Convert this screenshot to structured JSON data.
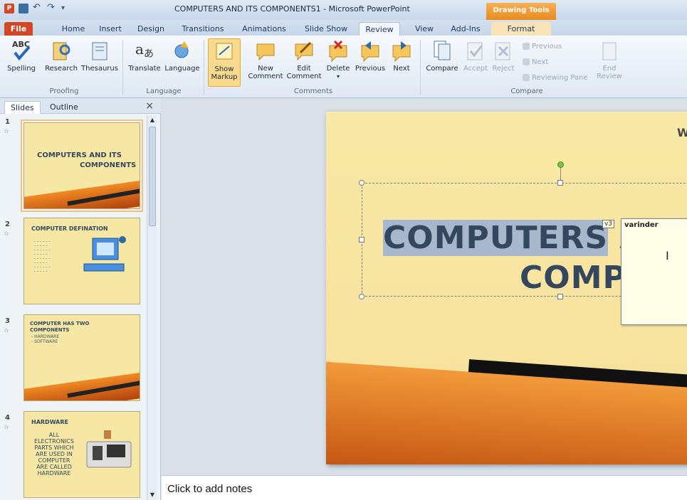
{
  "window": {
    "title": "COMPUTERS AND ITS COMPONENTS1 - Microsoft PowerPoint",
    "context_tab_header": "Drawing Tools"
  },
  "tabs": [
    "File",
    "Home",
    "Insert",
    "Design",
    "Transitions",
    "Animations",
    "Slide Show",
    "Review",
    "View",
    "Add-Ins",
    "Format"
  ],
  "ribbon": {
    "proofing": {
      "label": "Proofing",
      "spelling": "Spelling",
      "research": "Research",
      "thesaurus": "Thesaurus"
    },
    "language": {
      "label": "Language",
      "translate": "Translate",
      "language": "Language"
    },
    "comments": {
      "label": "Comments",
      "show_markup_1": "Show",
      "show_markup_2": "Markup",
      "new_1": "New",
      "new_2": "Comment",
      "edit_1": "Edit",
      "edit_2": "Comment",
      "delete": "Delete",
      "previous": "Previous",
      "next": "Next"
    },
    "compare": {
      "label": "Compare",
      "compare": "Compare",
      "accept": "Accept",
      "reject": "Reject",
      "prev_small": "Previous",
      "next_small": "Next",
      "reviewing_pane": "Reviewing Pane",
      "end_1": "End",
      "end_2": "Review"
    }
  },
  "pane": {
    "tab_slides": "Slides",
    "tab_outline": "Outline",
    "close": "×",
    "slides": [
      {
        "num": "1",
        "title_1": "COMPUTERS AND ITS",
        "title_2": "COMPONENTS"
      },
      {
        "num": "2",
        "title": "COMPUTER  DEFINATION"
      },
      {
        "num": "3",
        "title_1": "COMPUTER HAS TWO",
        "title_2": "COMPONENTS",
        "line_1": "- HARDWARE",
        "line_2": "- SOFTWARE"
      },
      {
        "num": "4",
        "title": "HARDWARE",
        "body": [
          "ALL",
          "ELECTRONICS",
          "PARTS WHICH",
          "ARE USED IN",
          "COMPUTER",
          "ARE CALLED",
          "HARDWARE"
        ]
      }
    ]
  },
  "slide": {
    "title_line_1_hl": "COMPUTERS",
    "title_line_1_rest": " A",
    "title_line_2": "COMPO",
    "corner_text": "W",
    "comment_marker": "v3",
    "comment_author": "varinder"
  },
  "notes": {
    "placeholder": "Click to add notes"
  },
  "colors": {
    "file_tab": "#d24726",
    "slide_bg": "#f7e7a4",
    "accent": "#e98b1d"
  }
}
